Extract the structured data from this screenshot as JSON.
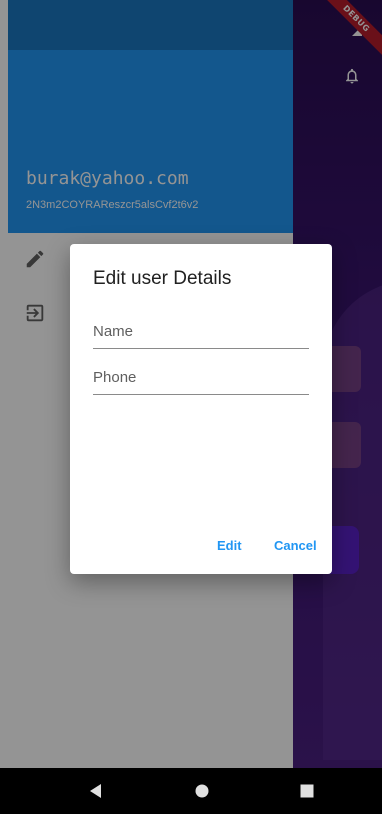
{
  "debug_banner": "DEBUG",
  "drawer": {
    "email": "burak@yahoo.com",
    "uid": "2N3m2COYRAReszcr5alsCvf2t6v2",
    "items": [
      {
        "icon": "edit-icon"
      },
      {
        "icon": "logout-icon"
      }
    ]
  },
  "dialog": {
    "title": "Edit user Details",
    "name_placeholder": "Name",
    "phone_placeholder": "Phone",
    "edit_label": "Edit",
    "cancel_label": "Cancel"
  },
  "navbar": {
    "icons": [
      "back-icon",
      "home-icon",
      "recents-icon"
    ]
  },
  "colors": {
    "drawer_header": "#2196f3",
    "accent": "#2196f3",
    "debug_banner": "#b71c2c",
    "app_background": "#2a0d52"
  }
}
